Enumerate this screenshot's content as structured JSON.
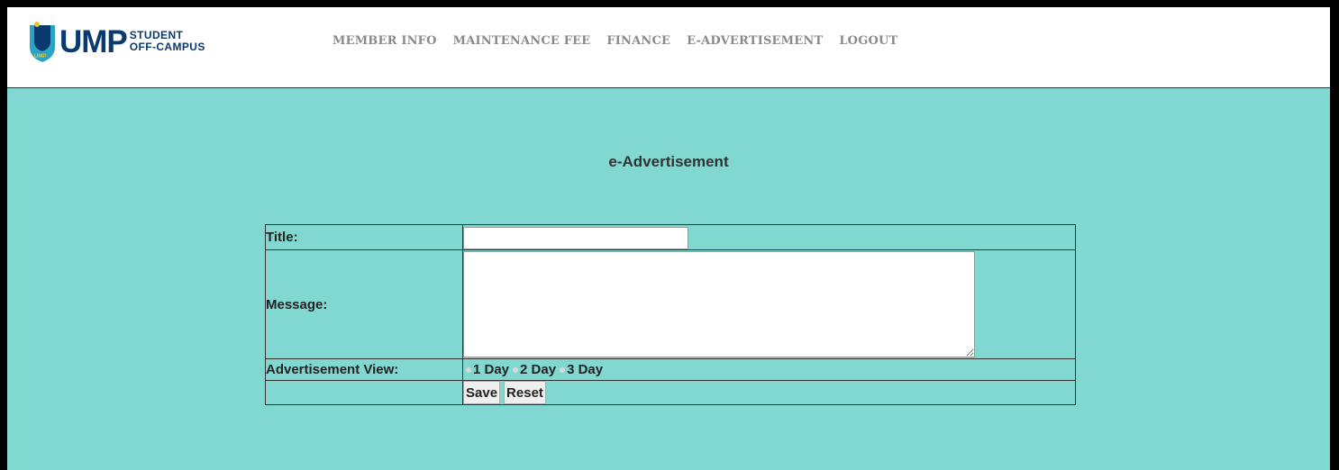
{
  "brand": {
    "name": "UMP",
    "sub_line1": "STUDENT",
    "sub_line2": "OFF-CAMPUS",
    "colors": {
      "primary": "#0b3a6e",
      "accent": "#2aa3c4",
      "gold": "#e9c230"
    }
  },
  "nav": {
    "items": [
      {
        "label": "MEMBER INFO"
      },
      {
        "label": "MAINTENANCE FEE"
      },
      {
        "label": "FINANCE"
      },
      {
        "label": "E-ADVERTISEMENT"
      },
      {
        "label": "LOGOUT"
      }
    ]
  },
  "page": {
    "title": "e-Advertisement",
    "background": "#80d8d0"
  },
  "form": {
    "title_label": "Title:",
    "title_value": "",
    "message_label": "Message:",
    "message_value": "",
    "view_label": "Advertisement View:",
    "view_options": [
      "1 Day",
      "2 Day",
      "3 Day"
    ],
    "save_label": "Save",
    "reset_label": "Reset"
  }
}
